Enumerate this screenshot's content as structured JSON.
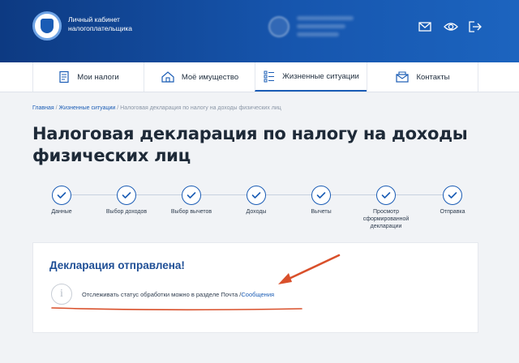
{
  "header": {
    "brand_line1": "Личный кабинет",
    "brand_line2": "налогоплательщика",
    "icons": [
      "mail-icon",
      "eye-icon",
      "logout-icon"
    ]
  },
  "nav": {
    "items": [
      {
        "label": "Мои налоги",
        "icon": "taxes-icon"
      },
      {
        "label": "Моё имущество",
        "icon": "property-icon"
      },
      {
        "label": "Жизненные ситуации",
        "icon": "checklist-icon",
        "active": true
      },
      {
        "label": "Контакты",
        "icon": "contacts-icon"
      }
    ]
  },
  "breadcrumb": {
    "home": "Главная",
    "section": "Жизненные ситуации",
    "current": "Налоговая декларация по налогу на доходы физических лиц",
    "separator": "/"
  },
  "page": {
    "title": "Налоговая декларация по налогу на доходы физических лиц"
  },
  "steps": [
    {
      "label": "Данные",
      "done": true
    },
    {
      "label": "Выбор доходов",
      "done": true
    },
    {
      "label": "Выбор вычетов",
      "done": true
    },
    {
      "label": "Доходы",
      "done": true
    },
    {
      "label": "Вычеты",
      "done": true
    },
    {
      "label": "Просмотр сформированной декларации",
      "done": true
    },
    {
      "label": "Отправка",
      "done": true
    }
  ],
  "result": {
    "title": "Декларация отправлена!",
    "info_text": "Отслеживать статус обработки можно в разделе Почта /",
    "info_link": "Сообщения",
    "info_icon": "i"
  },
  "colors": {
    "header_dark": "#0d3a82",
    "accent": "#1a5cb5",
    "annotation": "#d9502b"
  }
}
